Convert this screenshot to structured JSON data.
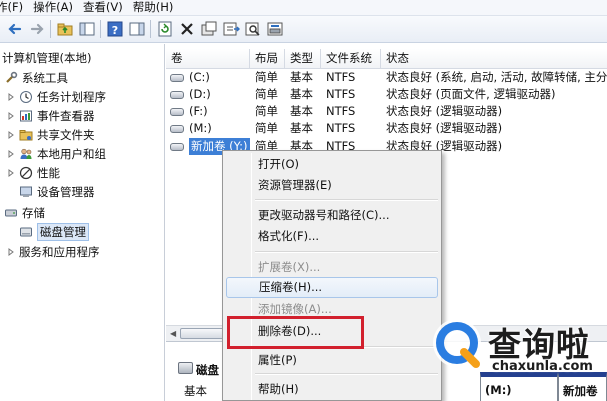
{
  "menubar": {
    "items": [
      "作(F)",
      "操作(A)",
      "查看(V)",
      "帮助(H)"
    ]
  },
  "icons": {
    "toolbar": [
      "back-arrow-icon",
      "forward-arrow-icon",
      "up-folder-icon",
      "show-tree-icon",
      "help-icon",
      "show-panel-icon",
      "refresh-icon",
      "delete-icon",
      "properties-icon",
      "export-icon",
      "search-icon",
      "disk-manage-icon"
    ]
  },
  "tree": {
    "root": "计算机管理(本地)",
    "items": [
      {
        "label": "系统工具",
        "icon": "tools-icon"
      },
      {
        "label": "任务计划程序",
        "icon": "clock-icon"
      },
      {
        "label": "事件查看器",
        "icon": "event-viewer-icon"
      },
      {
        "label": "共享文件夹",
        "icon": "shared-folder-icon"
      },
      {
        "label": "本地用户和组",
        "icon": "users-icon"
      },
      {
        "label": "性能",
        "icon": "no-entry-icon"
      },
      {
        "label": "设备管理器",
        "icon": "device-manager-icon"
      },
      {
        "label": "存储",
        "icon": "storage-icon"
      },
      {
        "label": "磁盘管理",
        "icon": "disk-icon"
      },
      {
        "label": "服务和应用程序",
        "icon": "services-icon"
      }
    ]
  },
  "table": {
    "headers": [
      "卷",
      "布局",
      "类型",
      "文件系统",
      "状态"
    ],
    "rows": [
      {
        "vol": "(C:)",
        "layout": "简单",
        "type": "基本",
        "fs": "NTFS",
        "status": "状态良好 (系统, 启动, 活动, 故障转储, 主分"
      },
      {
        "vol": "(D:)",
        "layout": "简单",
        "type": "基本",
        "fs": "NTFS",
        "status": "状态良好 (页面文件, 逻辑驱动器)"
      },
      {
        "vol": "(F:)",
        "layout": "简单",
        "type": "基本",
        "fs": "NTFS",
        "status": "状态良好 (逻辑驱动器)"
      },
      {
        "vol": "(M:)",
        "layout": "简单",
        "type": "基本",
        "fs": "NTFS",
        "status": "状态良好 (逻辑驱动器)"
      },
      {
        "vol": "新加卷 (Y:)",
        "layout": "简单",
        "type": "基本",
        "fs": "NTFS",
        "status": "状态良好 (逻辑驱动器)"
      }
    ]
  },
  "diskarea": {
    "disk_label": "磁盘",
    "disk_type": "基本",
    "partitions": [
      "(M:)",
      "新加卷"
    ]
  },
  "context_menu": {
    "items": [
      {
        "label": "打开(O)",
        "disabled": false
      },
      {
        "label": "资源管理器(E)",
        "disabled": false
      },
      {
        "label": "更改驱动器号和路径(C)...",
        "disabled": false
      },
      {
        "label": "格式化(F)...",
        "disabled": false
      },
      {
        "label": "扩展卷(X)...",
        "disabled": true
      },
      {
        "label": "压缩卷(H)...",
        "disabled": false
      },
      {
        "label": "添加镜像(A)...",
        "disabled": true
      },
      {
        "label": "删除卷(D)...",
        "disabled": false
      },
      {
        "label": "属性(P)",
        "disabled": false
      },
      {
        "label": "帮助(H)",
        "disabled": false
      }
    ]
  },
  "highlight": {
    "color": "#d2202d"
  },
  "watermark": {
    "text": "查询啦",
    "url": "chaxunla.com",
    "colors": {
      "blue": "#2a7de1",
      "orange": "#f5a019"
    }
  }
}
